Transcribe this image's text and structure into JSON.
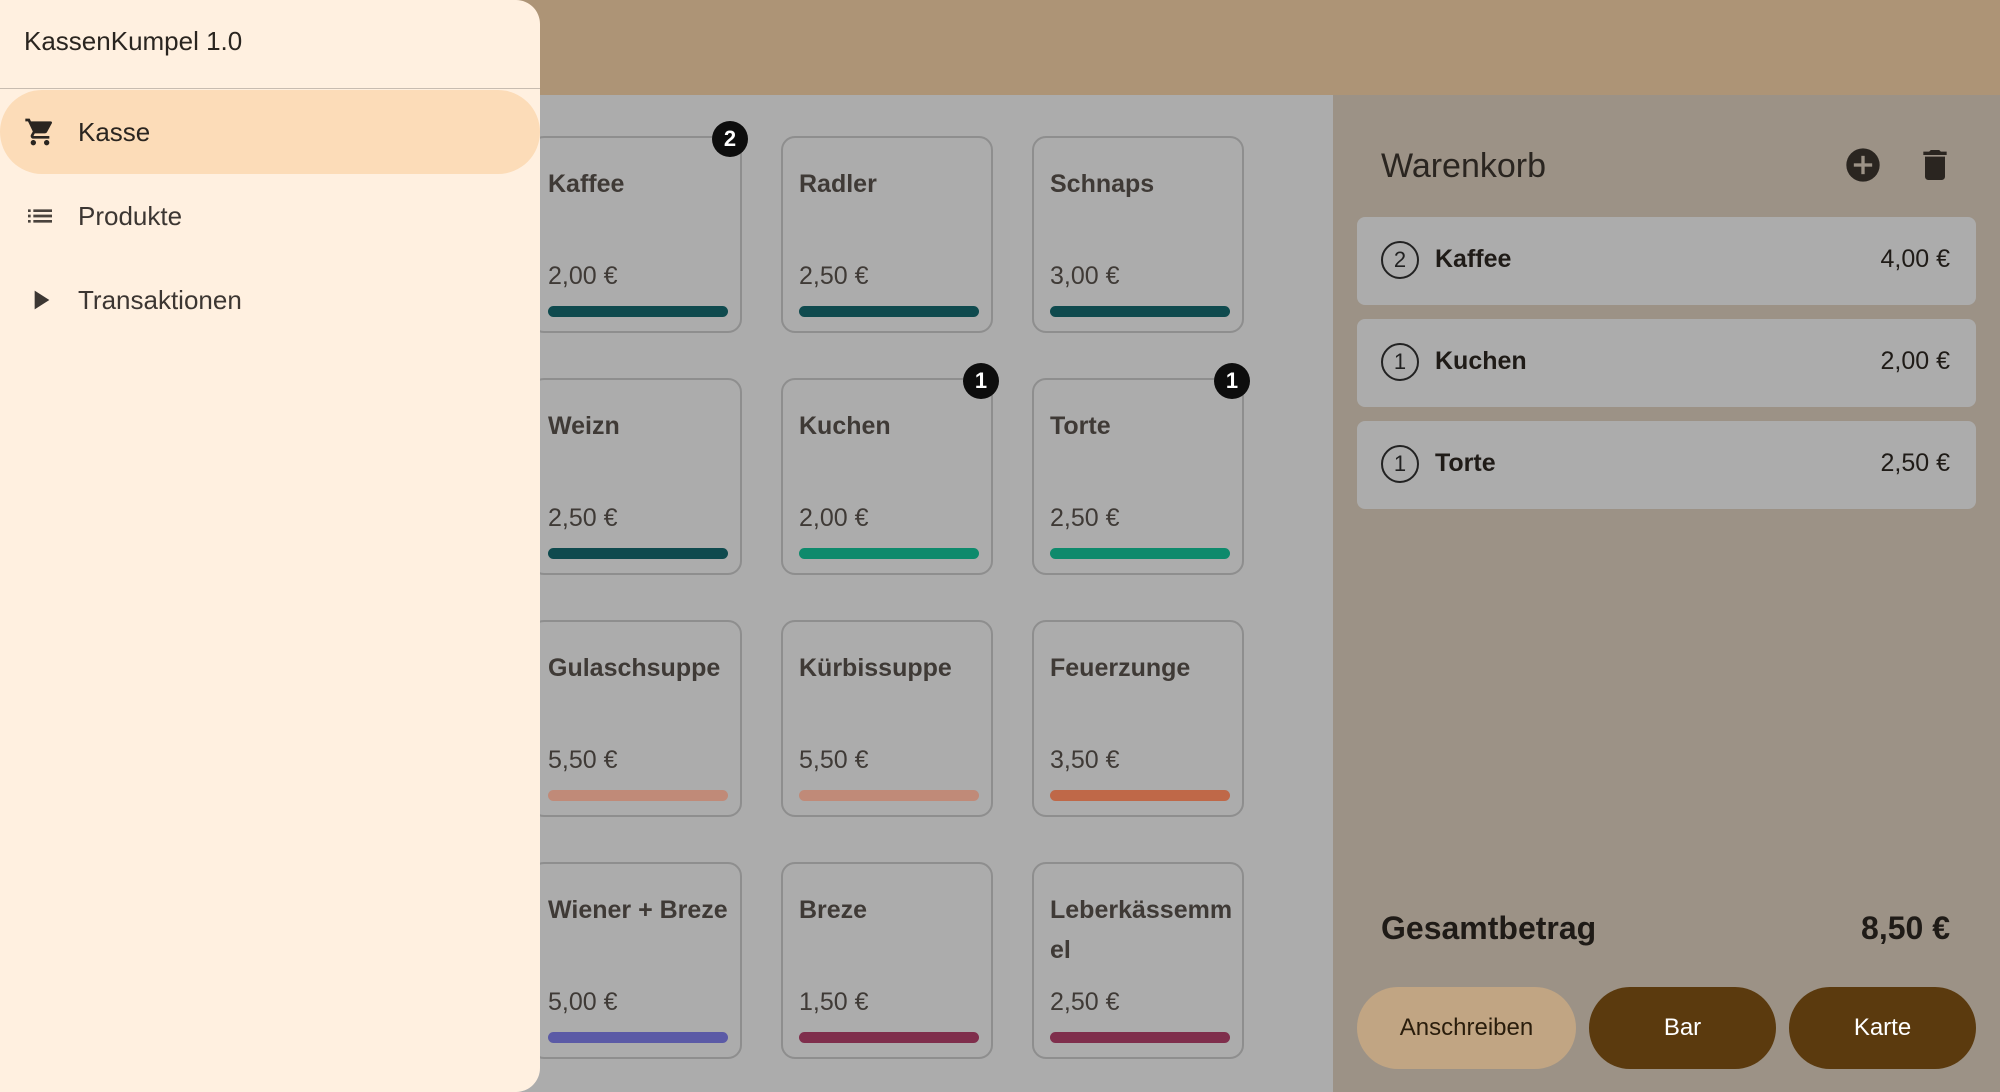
{
  "app": {
    "title": "KassenKumpel 1.0"
  },
  "nav": {
    "items": [
      {
        "label": "Kasse",
        "icon": "cart-icon",
        "active": true
      },
      {
        "label": "Produkte",
        "icon": "list-icon",
        "active": false
      },
      {
        "label": "Transaktionen",
        "icon": "play-arrow-icon",
        "active": false
      }
    ]
  },
  "products": [
    {
      "name": "Kaffee",
      "price": "2,00 €",
      "color": "#0f4a4e",
      "badge": "2"
    },
    {
      "name": "Radler",
      "price": "2,50 €",
      "color": "#0f4a4e",
      "badge": ""
    },
    {
      "name": "Schnaps",
      "price": "3,00 €",
      "color": "#0f4a4e",
      "badge": ""
    },
    {
      "name": "Weizn",
      "price": "2,50 €",
      "color": "#0f4a4e",
      "badge": ""
    },
    {
      "name": "Kuchen",
      "price": "2,00 €",
      "color": "#0e8a6c",
      "badge": "1"
    },
    {
      "name": "Torte",
      "price": "2,50 €",
      "color": "#0e8a6c",
      "badge": "1"
    },
    {
      "name": "Gulaschsuppe",
      "price": "5,50 €",
      "color": "#c08a78",
      "badge": ""
    },
    {
      "name": "Kürbissuppe",
      "price": "5,50 €",
      "color": "#c08a78",
      "badge": ""
    },
    {
      "name": "Feuerzunge",
      "price": "3,50 €",
      "color": "#bf6848",
      "badge": ""
    },
    {
      "name": "Wiener + Breze",
      "price": "5,00 €",
      "color": "#5b5aa6",
      "badge": ""
    },
    {
      "name": "Breze",
      "price": "1,50 €",
      "color": "#7f2e4c",
      "badge": ""
    },
    {
      "name": "Leberkässemmel",
      "price": "2,50 €",
      "color": "#7f2e4c",
      "badge": ""
    }
  ],
  "cart": {
    "title": "Warenkorb",
    "items": [
      {
        "qty": "2",
        "name": "Kaffee",
        "price": "4,00 €"
      },
      {
        "qty": "1",
        "name": "Kuchen",
        "price": "2,00 €"
      },
      {
        "qty": "1",
        "name": "Torte",
        "price": "2,50 €"
      }
    ],
    "total_label": "Gesamtbetrag",
    "total_value": "8,50 €",
    "buttons": {
      "anschreiben": "Anschreiben",
      "bar": "Bar",
      "karte": "Karte"
    }
  },
  "colors": {
    "app_bar": "#ad9476",
    "drawer": "#fff0e0",
    "nav_active": "#fcdcb8",
    "primary_button": "#5b3a0e",
    "secondary_button": "#c1a583"
  }
}
